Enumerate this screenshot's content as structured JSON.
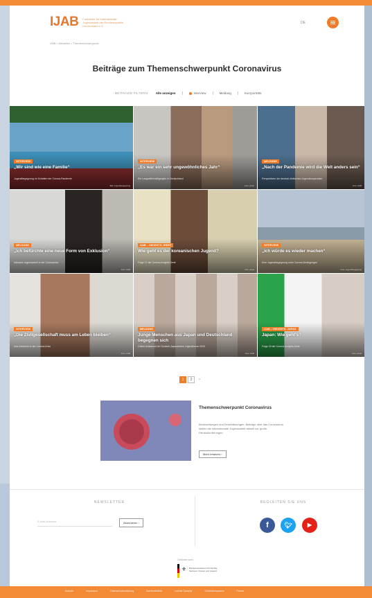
{
  "header": {
    "logo": "IJAB",
    "tagline": "Fachstelle für Internationale Jugendarbeit der Bundesrepublik Deutschland e.V.",
    "language": "DE",
    "breadcrumb": "IJAB  >  Aktuelles  >  Themenschwerpunkt"
  },
  "page_title": "Beiträge zum Themenschwerpunkt Coronavirus",
  "filters": {
    "label": "BEITRÄGE FILTERN:",
    "items": [
      "Alle anzeigen",
      "Interview",
      "Meldung",
      "Kurzporträts"
    ]
  },
  "cards": [
    {
      "tag": "INTERVIEW",
      "title": "„Wir sind wie eine Familie“",
      "sub": "Jugendbegegnung im Schatten der Corona-Pandemie",
      "credit": "Bild: Jugendbegegnung"
    },
    {
      "tag": "INTERVIEW",
      "title": "„Es war ein sehr ungewöhnliches Jahr“",
      "sub": "Ein Langzeitfreiwilligenjahr in Deutschland",
      "credit": "Foto: privat"
    },
    {
      "tag": "MELDUNG",
      "title": "„Nach der Pandemie wird die Welt anders sein“",
      "sub": "Perspektiven der deutsch-türkischen Jugendkooperation",
      "credit": "Foto: IJAB"
    },
    {
      "tag": "MELDUNG",
      "title": "„Ich befürchte eine neue Form von Exklusion“",
      "sub": "Inklusive Jugendarbeit in der Coronakrise",
      "credit": "Foto: IJAB"
    },
    {
      "tag": "IJAB – INSIGHTS: BRIEF",
      "title": "Wie geht es der koreanischen Jugend?",
      "sub": "Folge 17 der Corona-Insights-Serie",
      "credit": "Foto: privat"
    },
    {
      "tag": "INTERVIEW",
      "title": "„Ich würde es wieder machen“",
      "sub": "Eine Jugendbegegnung unter Corona-Bedingungen",
      "credit": "Foto: Jugendbegegnung"
    },
    {
      "tag": "INTERVIEW",
      "title": "„Die Zivilgesellschaft muss am Leben bleiben“",
      "sub": "Das Netzwerk in der Corona-Krise",
      "credit": "Foto: IJAB"
    },
    {
      "tag": "MELDUNG",
      "title": "Junge Menschen aus Japan und Deutschland begegnen sich",
      "sub": "Online-Austausch im Deutsch-Japanischen Jugendforum 2020",
      "credit": "Foto: IJAB"
    },
    {
      "tag": "IJAB – INSIGHTS: JAPAN",
      "title": "Japan: Wie geht's?",
      "sub": "Folge 18 der Corona-Insights-Serie",
      "credit": "Foto: privat"
    }
  ],
  "pagination": {
    "current": "1",
    "other": "2",
    "next": "›"
  },
  "teaser": {
    "title": "Themenschwerpunkt Coronavirus",
    "text": "Beobachtungen und Einschätzungen: Beiträge über das Coronavirus stellen die internationale Jugendarbeit aktuell vor große Herausforderungen.",
    "button": "Mehr erfahren  ›"
  },
  "newsletter": {
    "title": "NEWSLETTER",
    "placeholder": "E-Mail-Adresse",
    "button": "Abonnieren  ›"
  },
  "social": {
    "title": "BEGLEITEN SIE UNS",
    "icons": [
      "facebook-icon",
      "twitter-icon",
      "youtube-icon"
    ]
  },
  "funding": {
    "label": "Gefördert vom:",
    "ministry": "Bundesministerium für Familie, Senioren, Frauen und Jugend"
  },
  "footer": {
    "links": [
      "Kontakt",
      "Impressum",
      "Datenschutzerklärung",
      "Barrierefreiheit",
      "Leichte Sprache",
      "Gebärdensprache",
      "Presse"
    ]
  },
  "colors": {
    "accent": "#f07c2a",
    "facebook": "#3b5998",
    "twitter": "#1da1f2",
    "youtube": "#e62117"
  }
}
